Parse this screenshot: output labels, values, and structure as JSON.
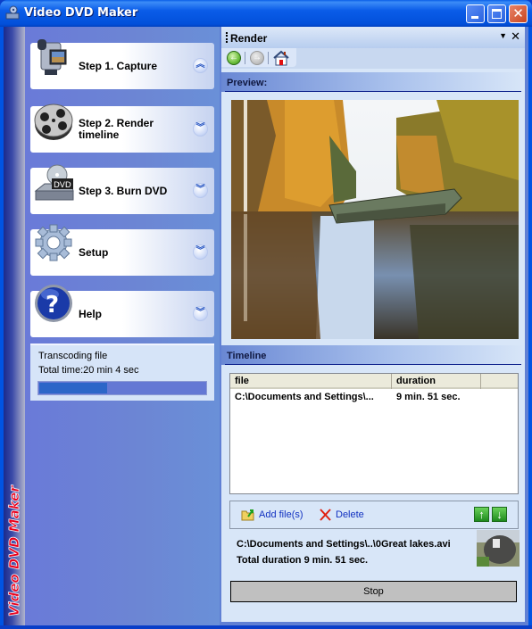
{
  "window": {
    "title": "Video DVD Maker",
    "side_brand": "Video DVD Maker",
    "controls": {
      "minimize": "minimize",
      "maximize": "maximize",
      "close": "✕"
    }
  },
  "steps": [
    {
      "label": "Step 1. Capture",
      "icon": "camcorder-icon",
      "expanded": true,
      "chevron": "︽"
    },
    {
      "label": "Step 2. Render timeline",
      "icon": "film-reel-icon",
      "expanded": false,
      "chevron": "︾"
    },
    {
      "label": "Step 3. Burn DVD",
      "icon": "dvd-drive-icon",
      "expanded": false,
      "chevron": "︾"
    },
    {
      "label": "Setup",
      "icon": "gear-icon",
      "expanded": false,
      "chevron": "︾"
    },
    {
      "label": "Help",
      "icon": "help-icon",
      "expanded": false,
      "chevron": "︾"
    }
  ],
  "status": {
    "line1": "Transcoding file",
    "line2": "Total time:20 min 4 sec",
    "progress_fraction": 0.41
  },
  "panel": {
    "title": "Render",
    "dropdown_glyph": "▼",
    "close_glyph": "✕",
    "toolbar": {
      "back": "←",
      "forward": "→",
      "home": "home"
    },
    "preview_label": "Preview:",
    "timeline_label": "Timeline"
  },
  "timeline": {
    "columns": [
      "file",
      "duration",
      ""
    ],
    "rows": [
      {
        "file": "C:\\Documents and Settings\\...",
        "duration": "9 min. 51 sec."
      }
    ]
  },
  "actions": {
    "add": "Add file(s)",
    "delete": "Delete",
    "move_up": "↑",
    "move_down": "↓"
  },
  "current": {
    "path": "C:\\Documents and Settings\\..\\0Great lakes.avi",
    "total": "Total duration 9 min. 51 sec."
  },
  "stop_label": "Stop",
  "colors": {
    "accent": "#0054e3",
    "sidebar": "#6a86d4",
    "panel": "#d8e6f8",
    "progress": "#2c66c8",
    "brand_red": "#e8001c"
  }
}
